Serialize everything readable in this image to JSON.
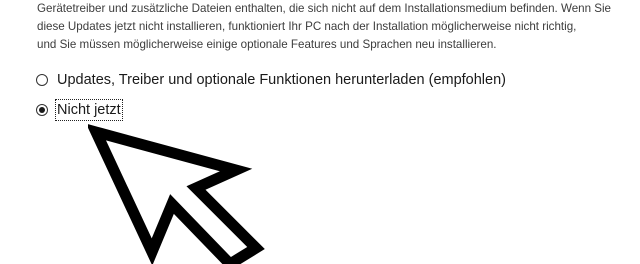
{
  "description": {
    "line1": "Gerätetreiber und zusätzliche Dateien enthalten, die sich nicht auf dem Installationsmedium befinden. Wenn Sie",
    "line2": "diese Updates jetzt nicht installieren, funktioniert Ihr PC nach der Installation möglicherweise nicht richtig,",
    "line3": "und Sie müssen möglicherweise einige optionale Features und Sprachen neu installieren."
  },
  "options": [
    {
      "label": "Updates, Treiber und optionale Funktionen herunterladen (empfohlen)",
      "selected": false
    },
    {
      "label": "Nicht jetzt",
      "selected": true
    }
  ],
  "icons": {
    "cursor": "mouse-pointer-arrow-icon"
  }
}
